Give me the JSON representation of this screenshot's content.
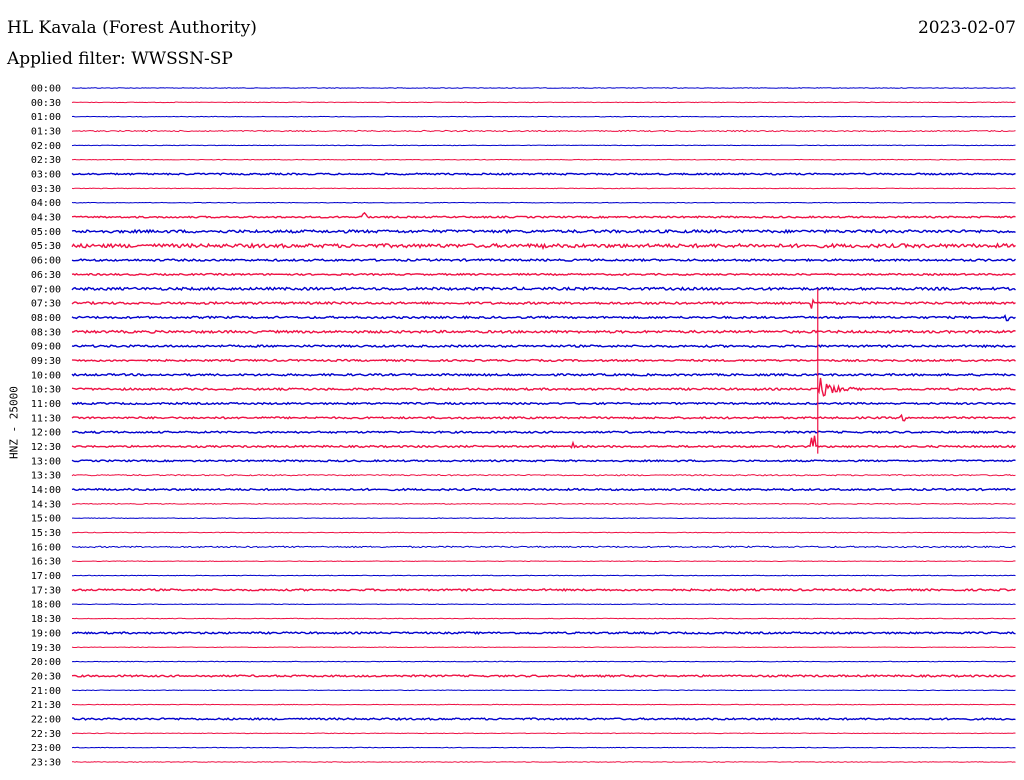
{
  "header": {
    "station": "HL Kavala (Forest Authority)",
    "date": "2023-02-07",
    "filter": "Applied filter: WWSSN-SP"
  },
  "colors": {
    "even": "#0000cc",
    "odd": "#ee1144"
  },
  "chart_data": {
    "type": "line",
    "ylabel": "HNZ - 25000",
    "row_labels": [
      "00:00",
      "00:30",
      "01:00",
      "01:30",
      "02:00",
      "02:30",
      "03:00",
      "03:30",
      "04:00",
      "04:30",
      "05:00",
      "05:30",
      "06:00",
      "06:30",
      "07:00",
      "07:30",
      "08:00",
      "08:30",
      "09:00",
      "09:30",
      "10:00",
      "10:30",
      "11:00",
      "11:30",
      "12:00",
      "12:30",
      "13:00",
      "13:30",
      "14:00",
      "14:30",
      "15:00",
      "15:30",
      "16:00",
      "16:30",
      "17:00",
      "17:30",
      "18:00",
      "18:30",
      "19:00",
      "19:30",
      "20:00",
      "20:30",
      "21:00",
      "21:30",
      "22:00",
      "22:30",
      "23:00",
      "23:30"
    ],
    "noise": [
      0.3,
      0.3,
      0.3,
      0.6,
      0.3,
      0.3,
      0.8,
      0.3,
      0.3,
      0.8,
      1.4,
      1.8,
      1.0,
      0.8,
      1.3,
      1.1,
      1.0,
      1.2,
      1.0,
      0.9,
      1.0,
      1.0,
      0.9,
      0.9,
      0.9,
      0.9,
      0.8,
      0.6,
      0.9,
      0.4,
      0.3,
      0.3,
      0.7,
      0.3,
      0.3,
      0.9,
      0.3,
      0.3,
      0.9,
      0.3,
      0.3,
      0.9,
      0.3,
      0.3,
      0.9,
      0.3,
      0.3,
      0.3
    ],
    "events": [
      {
        "row": 9,
        "t": 0.31,
        "amp": 8
      },
      {
        "row": 11,
        "t": 0.0,
        "amp": 3
      },
      {
        "row": 11,
        "t": 0.5,
        "amp": 4
      },
      {
        "row": 16,
        "t": 0.99,
        "amp": 4
      },
      {
        "row": 15,
        "t": 0.785,
        "amp": 14
      },
      {
        "row": 25,
        "t": 0.53,
        "amp": 12
      },
      {
        "row": 25,
        "t": 0.785,
        "amp": 10
      },
      {
        "row": 21,
        "t": 0.79,
        "amp": 18,
        "coda": true
      },
      {
        "row": 23,
        "t": 0.88,
        "amp": 3
      },
      {
        "row": 24,
        "t": 0.04,
        "amp": 3
      }
    ]
  }
}
